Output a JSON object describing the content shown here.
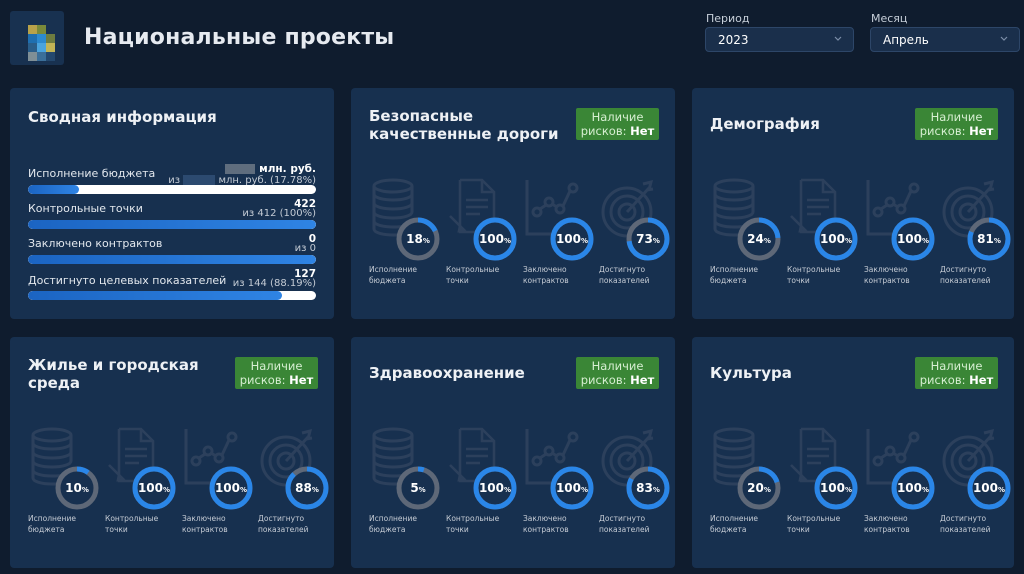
{
  "header": {
    "title": "Национальные проекты"
  },
  "filters": {
    "period": {
      "label": "Период",
      "value": "2023"
    },
    "month": {
      "label": "Месяц",
      "value": "Апрель"
    }
  },
  "summary": {
    "title": "Сводная информация",
    "rows": [
      {
        "label": "Исполнение бюджета",
        "value_suffix": "млн. руб.",
        "sub_prefix": "из",
        "sub_suffix": "млн. руб. (17.78%)",
        "progress": 17.78
      },
      {
        "label": "Контрольные точки",
        "value": "422",
        "sub": "из 412 (100%)",
        "progress": 100
      },
      {
        "label": "Заключено контрактов",
        "value": "0",
        "sub": "из 0",
        "progress": 100
      },
      {
        "label": "Достигнуто целевых показателей",
        "value": "127",
        "sub": "из 144 (88.19%)",
        "progress": 88.19
      }
    ]
  },
  "metric_labels": {
    "budget": [
      "Исполнение",
      "бюджета"
    ],
    "checkpoints": [
      "Контрольные",
      "точки"
    ],
    "contracts": [
      "Заключено",
      "контрактов"
    ],
    "indicators": [
      "Достигнуто",
      "показателей"
    ]
  },
  "projects": [
    {
      "title_lines": [
        "Безопасные",
        "качественные дороги"
      ],
      "risk_label": "Наличие",
      "risk_prefix": "рисков:",
      "risk_value": "Нет",
      "metrics": [
        18,
        100,
        100,
        73
      ]
    },
    {
      "title_lines": [
        "Демография"
      ],
      "risk_label": "Наличие",
      "risk_prefix": "рисков:",
      "risk_value": "Нет",
      "metrics": [
        24,
        100,
        100,
        81
      ]
    },
    {
      "title_lines": [
        "Жилье и городская",
        "среда"
      ],
      "risk_label": "Наличие",
      "risk_prefix": "рисков:",
      "risk_value": "Нет",
      "metrics": [
        10,
        100,
        100,
        88
      ]
    },
    {
      "title_lines": [
        "Здравоохранение"
      ],
      "risk_label": "Наличие",
      "risk_prefix": "рисков:",
      "risk_value": "Нет",
      "metrics": [
        5,
        100,
        100,
        83
      ]
    },
    {
      "title_lines": [
        "Культура"
      ],
      "risk_label": "Наличие",
      "risk_prefix": "рисков:",
      "risk_value": "Нет",
      "metrics": [
        20,
        100,
        100,
        100
      ]
    }
  ],
  "percent_sign": "%",
  "colors": {
    "background": "#0f1c2e",
    "card": "#17304f",
    "accent_blue": "#2a86e8",
    "ring_track": "#5e6878",
    "badge_green": "#3a8636"
  }
}
